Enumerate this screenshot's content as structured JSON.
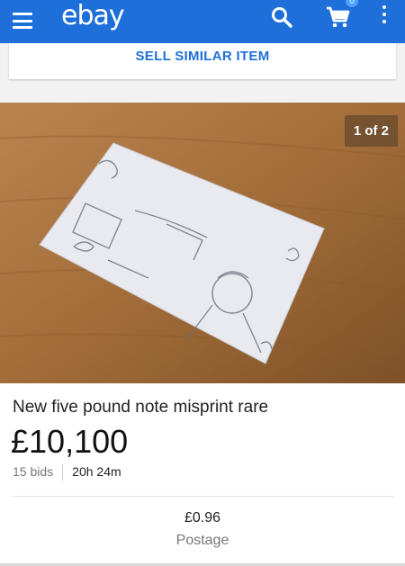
{
  "app": {
    "logo": "ebay",
    "cart_count": "0"
  },
  "actions": {
    "sell_similar_label": "SELL SIMILAR ITEM"
  },
  "gallery": {
    "counter": "1 of 2"
  },
  "item": {
    "title": "New five pound note misprint rare",
    "price": "£10,100",
    "bids": "15 bids",
    "time_left": "20h 24m",
    "postage_value": "£0.96",
    "postage_label": "Postage"
  },
  "colors": {
    "appbar": "#1e6fd9",
    "accent": "#1e6fd9"
  },
  "icons": [
    "menu-icon",
    "search-icon",
    "cart-icon",
    "more-vert-icon"
  ]
}
